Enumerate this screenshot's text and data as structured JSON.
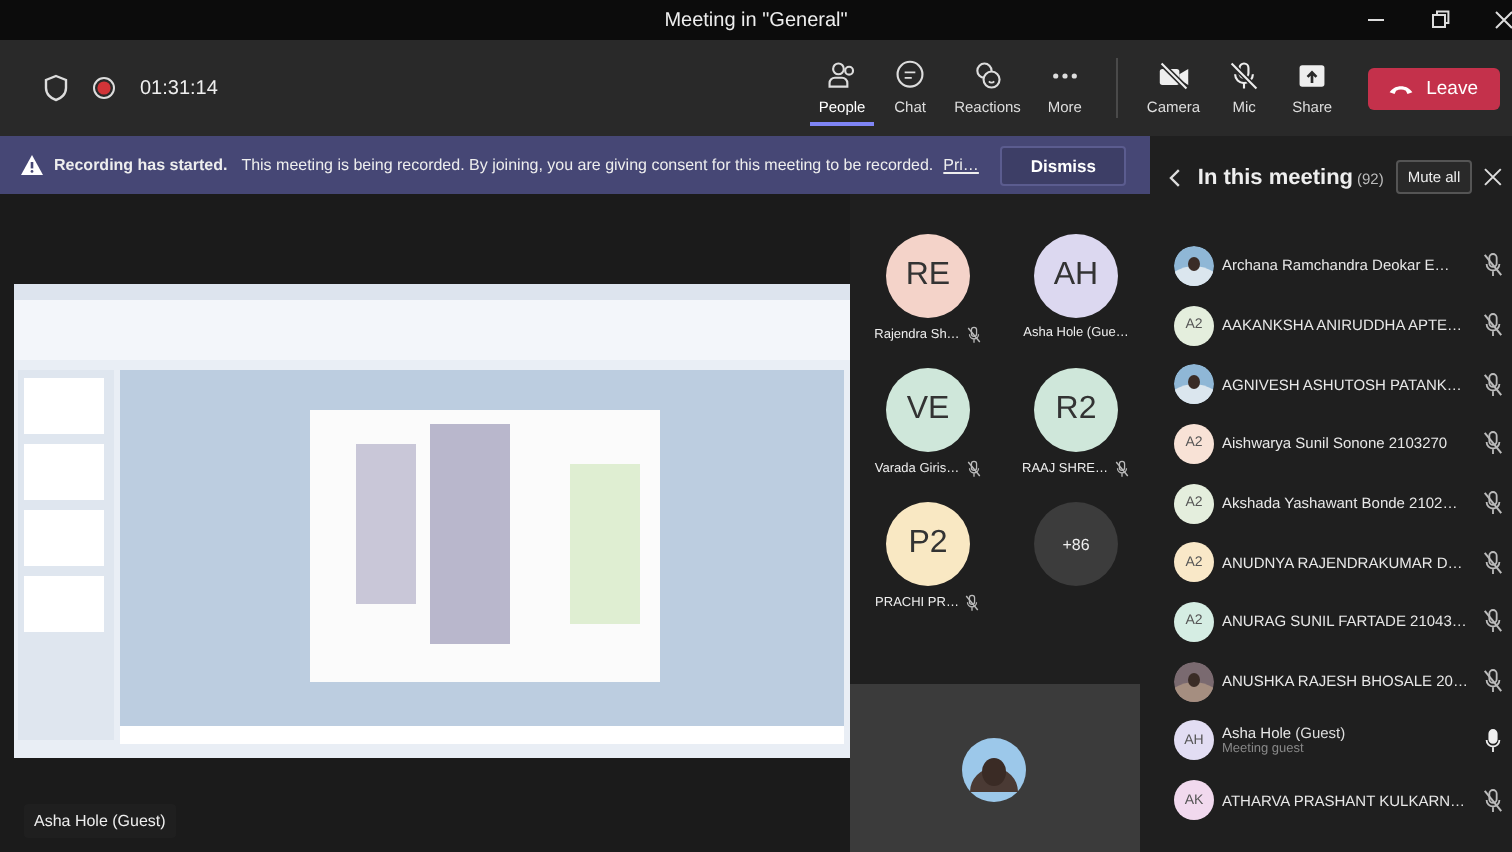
{
  "window": {
    "title": "Meeting in \"General\""
  },
  "toolbar": {
    "timer": "01:31:14",
    "recording": true,
    "buttons": [
      {
        "kind": "people",
        "label": "People",
        "selected": true
      },
      {
        "kind": "chat",
        "label": "Chat",
        "selected": false
      },
      {
        "kind": "reactions",
        "label": "Reactions",
        "selected": false
      },
      {
        "kind": "more",
        "label": "More",
        "selected": false
      }
    ],
    "devices": [
      {
        "kind": "camera",
        "label": "Camera",
        "off": true
      },
      {
        "kind": "mic",
        "label": "Mic",
        "off": true
      },
      {
        "kind": "share",
        "label": "Share",
        "off": false
      }
    ],
    "leave": "Leave"
  },
  "banner": {
    "title": "Recording has started.",
    "message": "This meeting is being recorded. By joining, you are giving consent for this meeting to be recorded.",
    "link": "Pri…",
    "dismiss": "Dismiss"
  },
  "stage": {
    "kind": "picture",
    "presenter": "Asha Hole (Guest)"
  },
  "gallery": {
    "tiles": [
      {
        "initials": "RE",
        "name": "Rajendra Sh…",
        "color": "#f4d3c9",
        "muted": true
      },
      {
        "initials": "AH",
        "name": "Asha Hole (Gue…",
        "color": "#dcd8f0",
        "muted": false
      },
      {
        "initials": "VE",
        "name": "Varada Giris…",
        "color": "#cfe7da",
        "muted": true
      },
      {
        "initials": "R2",
        "name": "RAAJ SHRE…",
        "color": "#cfe7da",
        "muted": true
      },
      {
        "initials": "P2",
        "name": "PRACHI PR…",
        "color": "#f9e8c3",
        "muted": true
      }
    ],
    "overflow": "+86"
  },
  "panel": {
    "title": "In this meeting",
    "count": "(92)",
    "mute_all": "Mute all",
    "participants": [
      {
        "kind": "picture",
        "name": "Archana Ramchandra Deokar E…",
        "muted": true
      },
      {
        "kind": "initials",
        "initials": "A2",
        "color": "#e4eedd",
        "name": "AAKANKSHA ANIRUDDHA APTE…",
        "muted": true
      },
      {
        "kind": "picture",
        "name": "AGNIVESH ASHUTOSH PATANK…",
        "muted": true
      },
      {
        "kind": "initials",
        "initials": "A2",
        "color": "#f8e2d6",
        "name": "Aishwarya Sunil Sonone 2103270",
        "muted": true
      },
      {
        "kind": "initials",
        "initials": "A2",
        "color": "#e4eedd",
        "name": "Akshada Yashawant Bonde 2102…",
        "muted": true
      },
      {
        "kind": "initials",
        "initials": "A2",
        "color": "#f9e8c8",
        "name": "ANUDNYA RAJENDRAKUMAR D…",
        "muted": true
      },
      {
        "kind": "initials",
        "initials": "A2",
        "color": "#d5ede3",
        "name": "ANURAG SUNIL FARTADE 21043…",
        "muted": true
      },
      {
        "kind": "picture",
        "name": "ANUSHKA RAJESH BHOSALE 20…",
        "muted": true
      },
      {
        "kind": "initials",
        "initials": "AH",
        "color": "#e2ddf3",
        "name": "Asha Hole",
        "tag": "(Guest)",
        "subtitle": "Meeting guest",
        "muted": false
      },
      {
        "kind": "initials",
        "initials": "AK",
        "color": "#f1d9ee",
        "name": "ATHARVA PRASHANT KULKARN…",
        "muted": true
      }
    ]
  }
}
